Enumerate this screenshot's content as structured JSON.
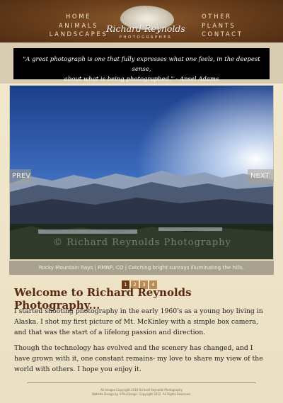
{
  "nav": {
    "left": [
      "HOME",
      "ANIMALS",
      "LANDSCAPES"
    ],
    "right": [
      "OTHER",
      "PLANTS",
      "CONTACT"
    ]
  },
  "logo": {
    "name": "Richard Reynolds",
    "subtitle": "PHOTOGRAPHER"
  },
  "quote": {
    "line1": "\"A great photograph is one that fully expresses what one feels, in the deepest sense,",
    "line2": "about what is being photographed.\" - Ansel Adams"
  },
  "slideshow": {
    "prev_label": "PREV",
    "next_label": "NEXT",
    "watermark": "© Richard Reynolds Photography",
    "caption": "Rocky Mountain Rays | RMNP, CO | Catching bright sunrays illuminating the hills.",
    "pages": [
      "1",
      "2",
      "3",
      "4"
    ],
    "active_page": "1"
  },
  "main": {
    "heading": "Welcome to Richard Reynolds Photography...",
    "paragraph1": "I started shooting photography in the early 1960's as a young boy living in Alaska. I shot my first picture of Mt. McKinley with a simple box camera, and that was the start of a lifelong passion and direction.",
    "paragraph2": "Though the technology has evolved and the scenery has changed, and I have grown with it, one constant remains- my love to share my view of the world with others. I hope you enjoy it."
  },
  "footer": {
    "line1": "All Images Copyright 2016 Richard Reynolds Photography",
    "line2": "Website Design by ©Pro Design. Copyright 2012. All Rights Reserved."
  },
  "colors": {
    "header_brown": "#6b3f1c",
    "heading_brown": "#5a2a10",
    "background_cream": "#f3ead2",
    "pager_active": "#6b3a14",
    "pager_inactive": "#b98a52"
  }
}
